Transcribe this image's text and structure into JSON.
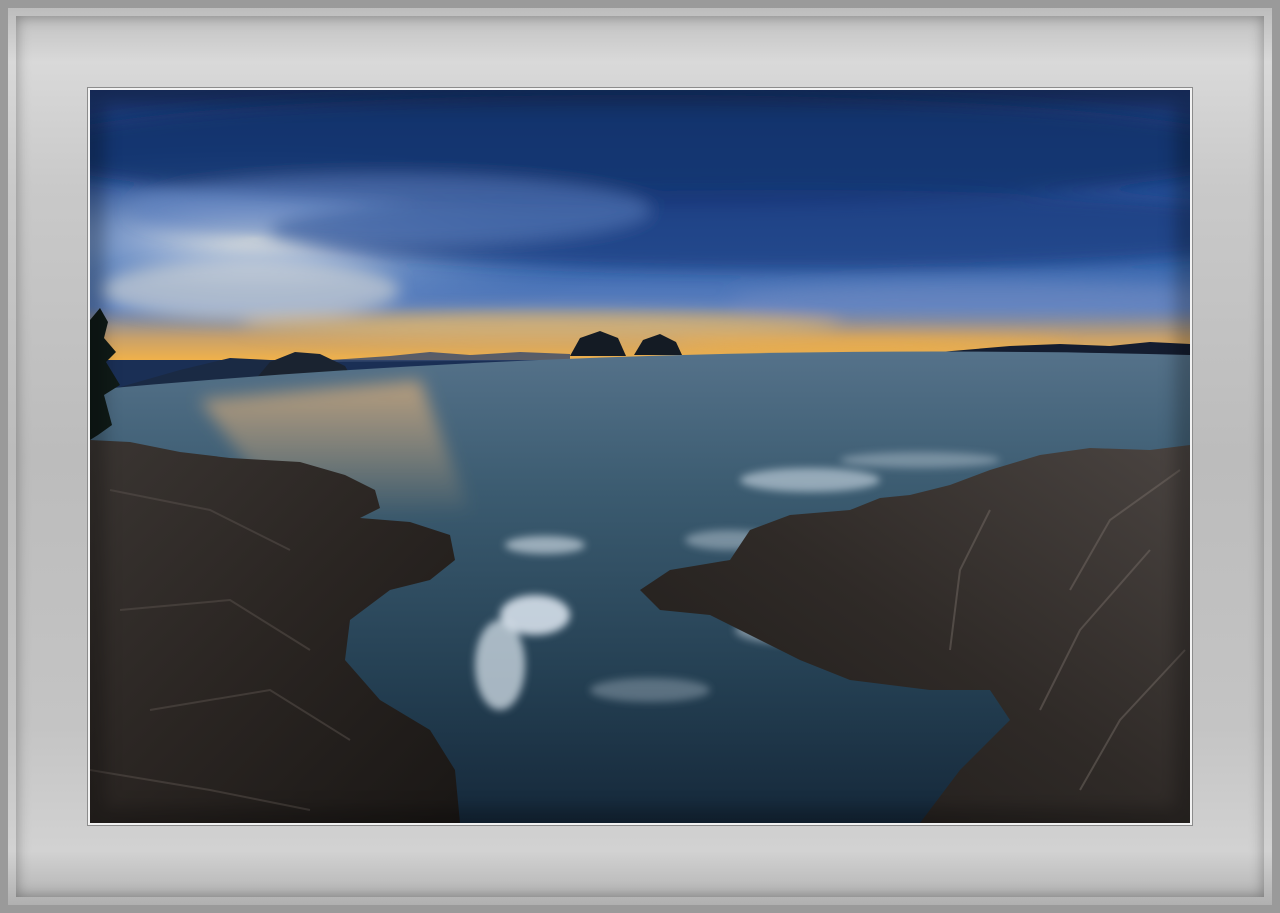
{
  "scene": {
    "type": "fisheye-seascape-at-dusk",
    "colors": {
      "sky_deep": "#1b3a78",
      "sky_mid": "#2f5aa6",
      "horizon_glow": "#f2b24a",
      "sea": "#2d4e64",
      "rock": "#2a2624",
      "frame_gray": "#c4c4c4"
    }
  }
}
